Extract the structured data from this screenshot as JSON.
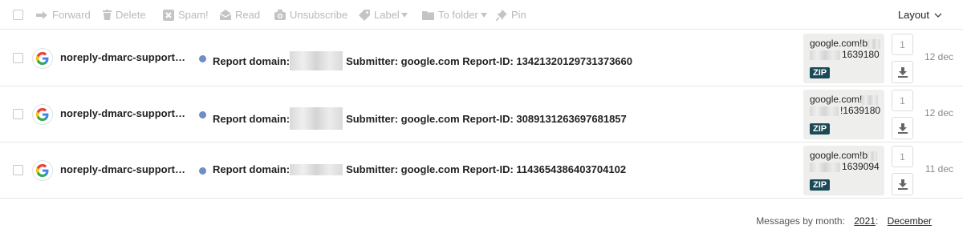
{
  "toolbar": {
    "forward": "Forward",
    "delete": "Delete",
    "spam": "Spam!",
    "read": "Read",
    "unsubscribe": "Unsubscribe",
    "label": "Label",
    "to_folder": "To folder",
    "pin": "Pin",
    "layout": "Layout"
  },
  "messages": [
    {
      "sender": "noreply-dmarc-support@google.com",
      "subject_prefix": "Report domain:",
      "subject_suffix": "Submitter: google.com Report-ID: 13421320129731373660",
      "attachment_line1": "google.com!b",
      "attachment_line2": "1639180",
      "attachment_type": "ZIP",
      "count": "1",
      "date": "12 dec"
    },
    {
      "sender": "noreply-dmarc-support@google.com",
      "subject_prefix": "Report domain:",
      "subject_suffix": "Submitter: google.com Report-ID: 3089131263697681857",
      "attachment_line1": "google.com!",
      "attachment_line2": "!1639180",
      "attachment_type": "ZIP",
      "count": "1",
      "date": "12 dec"
    },
    {
      "sender": "noreply-dmarc-support@google.com",
      "subject_prefix": "Report domain:",
      "subject_suffix": "Submitter: google.com Report-ID: 1143654386403704102",
      "attachment_line1": "google.com!b",
      "attachment_line2": "1639094",
      "attachment_type": "ZIP",
      "count": "1",
      "date": "11 dec"
    }
  ],
  "footer": {
    "label": "Messages by month:",
    "year": "2021",
    "year_sep": ":",
    "month": "December"
  },
  "colors": {
    "unread_dot": "#6f8ec9",
    "zip_badge": "#1a4a57",
    "disabled_text": "#b9b9b9"
  }
}
